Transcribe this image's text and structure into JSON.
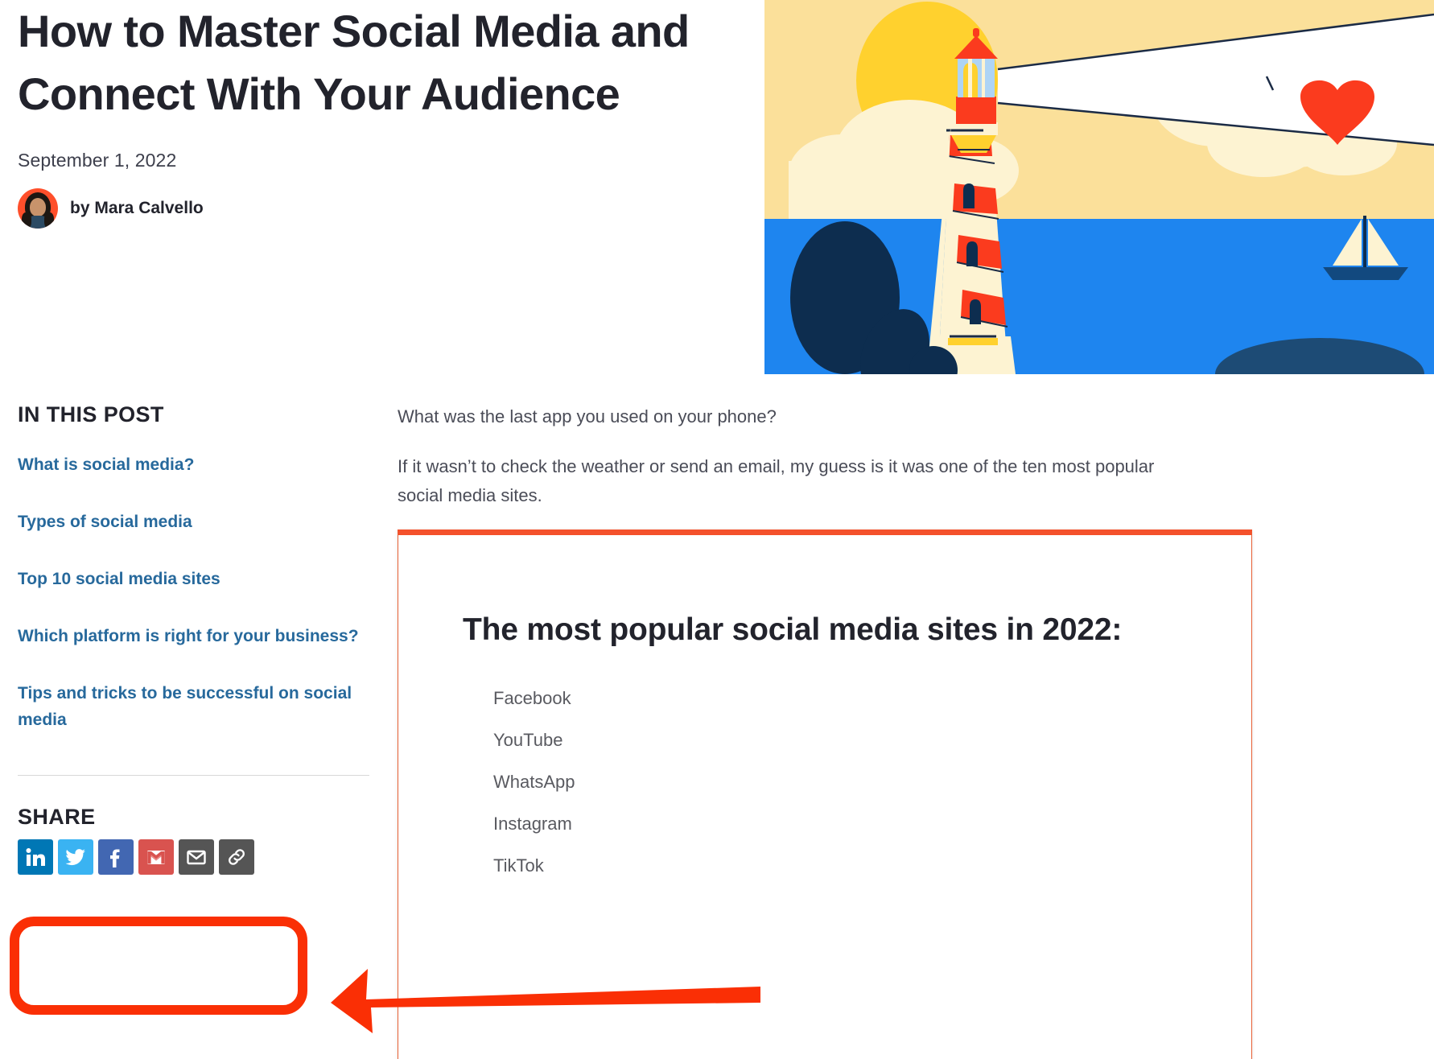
{
  "article": {
    "title": "How to Master Social Media and Connect With Your Audience",
    "date": "September 1, 2022",
    "byline": "by Mara Calvello"
  },
  "sidebar": {
    "heading": "IN THIS POST",
    "links": [
      "What is social media?",
      "Types of social media",
      "Top 10 social media sites",
      "Which platform is right for your business?",
      "Tips and tricks to be successful on social media"
    ]
  },
  "share": {
    "title": "SHARE",
    "icons": [
      {
        "name": "linkedin-icon",
        "label": "LinkedIn",
        "color": "#0077b5"
      },
      {
        "name": "twitter-icon",
        "label": "Twitter",
        "color": "#3ab3f2"
      },
      {
        "name": "facebook-icon",
        "label": "Facebook",
        "color": "#4267b2"
      },
      {
        "name": "gmail-icon",
        "label": "Gmail",
        "color": "#d9534f"
      },
      {
        "name": "email-icon",
        "label": "Email",
        "color": "#555555"
      },
      {
        "name": "copy-link-icon",
        "label": "Copy link",
        "color": "#555555"
      }
    ]
  },
  "main": {
    "paragraphs": [
      "What was the last app you used on your phone?",
      "If it wasn’t to check the weather or send an email, my guess is it was one of the ten most popular social media sites."
    ]
  },
  "callout": {
    "title": "The most popular social media sites in 2022:",
    "items": [
      "Facebook",
      "YouTube",
      "WhatsApp",
      "Instagram",
      "TikTok"
    ],
    "accent_color": "#f4512c"
  },
  "annotations": {
    "highlight_color": "#fa2f05",
    "share_box_target": "SHARE",
    "arrow_direction": "left"
  },
  "hero": {
    "alt": "lighthouse-illustration",
    "colors": {
      "sky": "#fbe09a",
      "sun": "#ffd12e",
      "cloud": "#fdf3d2",
      "sea": "#1e85ef",
      "rock": "#0d2d4f",
      "stripe": "#fb3b1e",
      "heart": "#fb3b1e"
    }
  }
}
